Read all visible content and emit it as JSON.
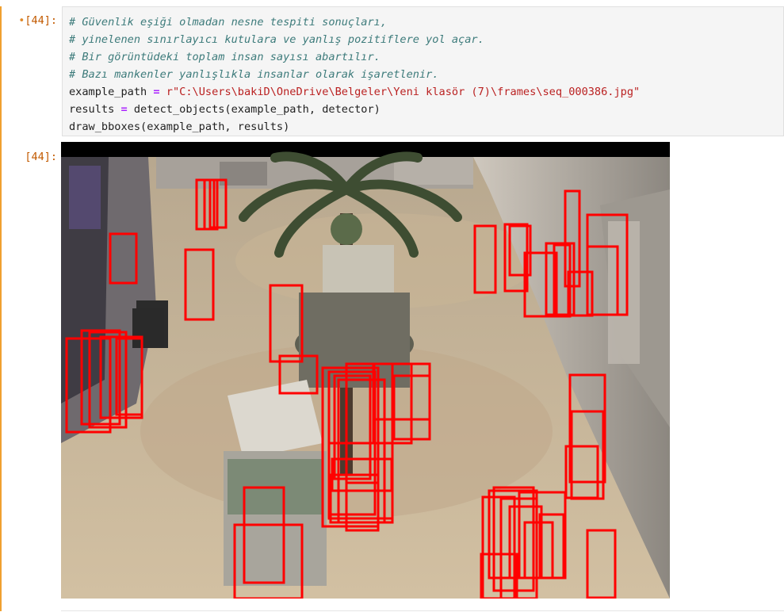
{
  "cell": {
    "input_prompt": "[44]:",
    "output_prompt": "[44]:",
    "dirty_marker": "•",
    "code": {
      "comment_1": "# Güvenlik eşiği olmadan nesne tespiti sonuçları,",
      "comment_2": "# yinelenen sınırlayıcı kutulara ve yanlış pozitiflere yol açar.",
      "comment_3": "# Bir görüntüdeki toplam insan sayısı abartılır.",
      "comment_4": "# Bazı mankenler yanlışlıkla insanlar olarak işaretlenir.",
      "line5_var": "example_path",
      "line5_op": "=",
      "line5_str": "r\"C:\\Users\\bakiD\\OneDrive\\Belgeler\\Yeni klasör (7)\\frames\\seq_000386.jpg\"",
      "line6_var": "results",
      "line6_op": "=",
      "line6_call": "detect_objects(example_path, detector)",
      "line7_call": "draw_bboxes(example_path, results)"
    }
  },
  "output": {
    "image_description_colors": {
      "floor": "#c9b79a",
      "box": "#ff0000"
    }
  }
}
